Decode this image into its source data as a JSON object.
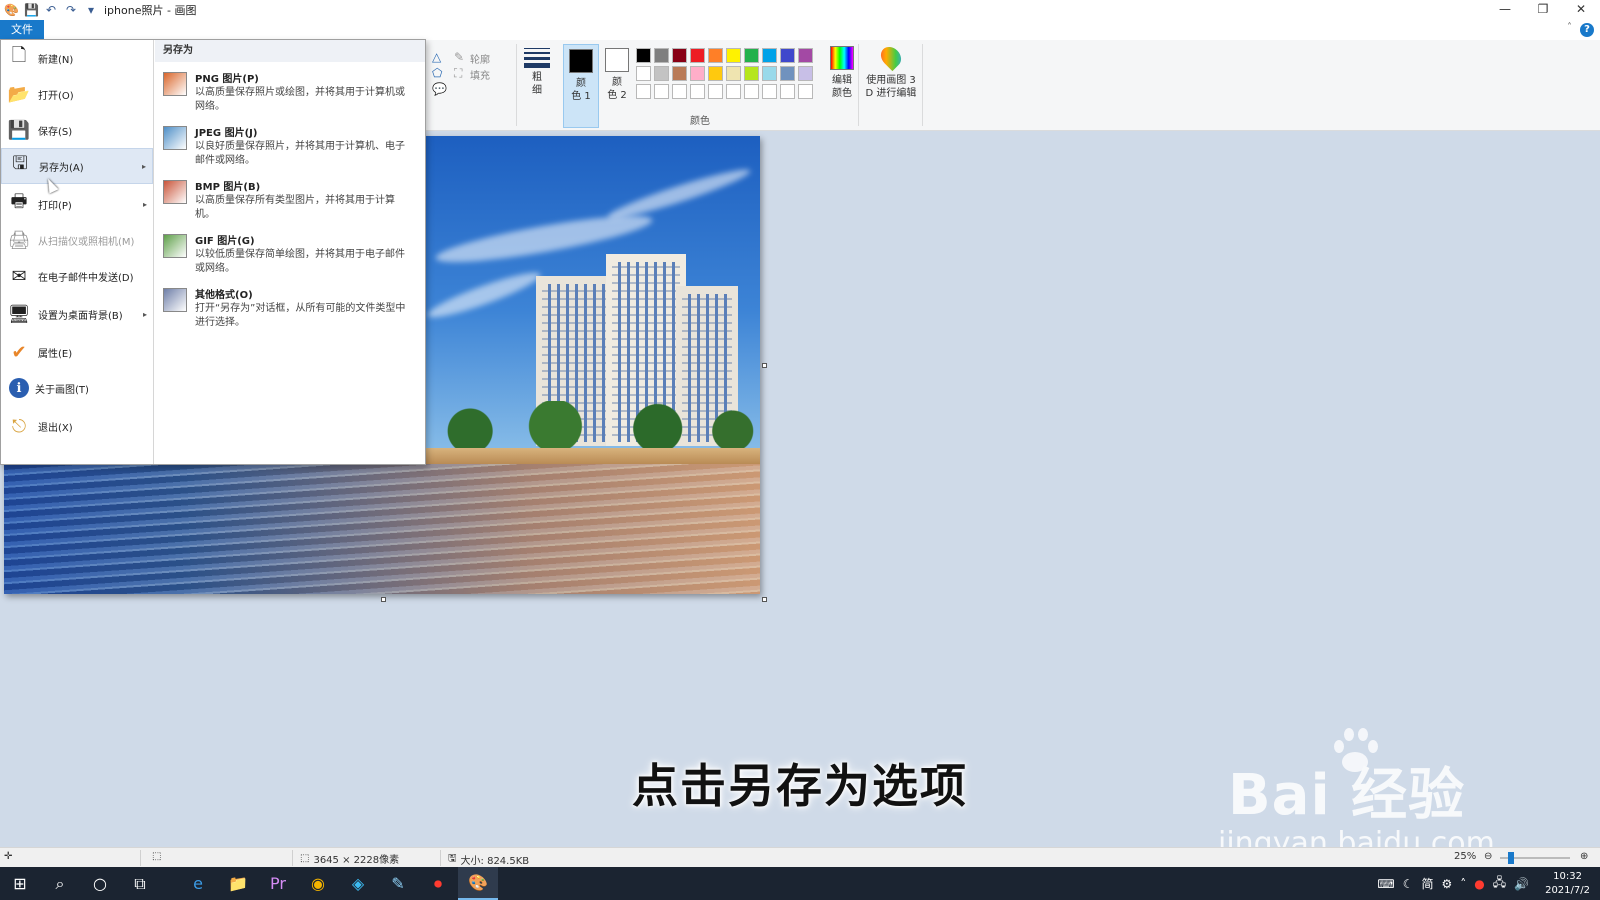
{
  "window": {
    "title": "iphone照片 - 画图",
    "controls": [
      "—",
      "❐",
      "✕"
    ]
  },
  "ribbon": {
    "file_tab": "文件",
    "help": "?",
    "outline_label": "轮廓",
    "fill_label": "填充",
    "size_label": "粗\n细",
    "color1_label": "颜\n色 1",
    "color2_label": "颜\n色 2",
    "colors_group": "颜色",
    "edit_colors_label": "编辑\n颜色",
    "paint3d_label": "使用画图 3\nD 进行编辑",
    "color1": "#000000",
    "color2": "#ffffff",
    "palette": [
      "#000000",
      "#7f7f7f",
      "#880015",
      "#ed1c24",
      "#ff7f27",
      "#fff200",
      "#22b14c",
      "#00a2e8",
      "#3f48cc",
      "#a349a4",
      "#ffffff",
      "#c3c3c3",
      "#b97a57",
      "#ffaec9",
      "#ffc90e",
      "#efe4b0",
      "#b5e61d",
      "#99d9ea",
      "#7092be",
      "#c8bfe7",
      "#ffffff",
      "#ffffff",
      "#ffffff",
      "#ffffff",
      "#ffffff",
      "#ffffff",
      "#ffffff",
      "#ffffff",
      "#ffffff",
      "#ffffff"
    ]
  },
  "file_menu": {
    "items": [
      {
        "label": "新建(N)",
        "icon": "new-file-icon",
        "glyph": "🗋",
        "has_submenu": false,
        "disabled": false
      },
      {
        "label": "打开(O)",
        "icon": "open-folder-icon",
        "glyph": "📂",
        "has_submenu": false,
        "disabled": false
      },
      {
        "label": "保存(S)",
        "icon": "save-icon",
        "glyph": "💾",
        "has_submenu": false,
        "disabled": false
      },
      {
        "label": "另存为(A)",
        "icon": "save-as-icon",
        "glyph": "🖫",
        "has_submenu": true,
        "disabled": false
      },
      {
        "label": "打印(P)",
        "icon": "printer-icon",
        "glyph": "🖶",
        "has_submenu": true,
        "disabled": false
      },
      {
        "label": "从扫描仪或照相机(M)",
        "icon": "scanner-icon",
        "glyph": "🖨",
        "has_submenu": false,
        "disabled": true
      },
      {
        "label": "在电子邮件中发送(D)",
        "icon": "email-icon",
        "glyph": "✉",
        "has_submenu": false,
        "disabled": false
      },
      {
        "label": "设置为桌面背景(B)",
        "icon": "desktop-background-icon",
        "glyph": "🖥",
        "has_submenu": true,
        "disabled": false
      },
      {
        "label": "属性(E)",
        "icon": "properties-check-icon",
        "glyph": "✔",
        "has_submenu": false,
        "disabled": false
      },
      {
        "label": "关于画图(T)",
        "icon": "info-icon",
        "glyph": "ℹ",
        "has_submenu": false,
        "disabled": false
      },
      {
        "label": "退出(X)",
        "icon": "exit-icon",
        "glyph": "⎋",
        "has_submenu": false,
        "disabled": false
      }
    ],
    "selected_index": 3,
    "submenu_title": "另存为",
    "submenu_items": [
      {
        "title": "PNG 图片(P)",
        "desc": "以高质量保存照片或绘图，并将其用于计算机或网络。",
        "icon": "png-image-icon",
        "color": "#d9662b"
      },
      {
        "title": "JPEG 图片(J)",
        "desc": "以良好质量保存照片，并将其用于计算机、电子邮件或网络。",
        "icon": "jpeg-image-icon",
        "color": "#4f8fc7"
      },
      {
        "title": "BMP 图片(B)",
        "desc": "以高质量保存所有类型图片，并将其用于计算机。",
        "icon": "bmp-image-icon",
        "color": "#c9553a"
      },
      {
        "title": "GIF 图片(G)",
        "desc": "以较低质量保存简单绘图，并将其用于电子邮件或网络。",
        "icon": "gif-image-icon",
        "color": "#5fa04a"
      },
      {
        "title": "其他格式(O)",
        "desc": "打开“另存为”对话框，从所有可能的文件类型中进行选择。",
        "icon": "other-formats-icon",
        "color": "#6f7fa8"
      }
    ]
  },
  "caption": "点击另存为选项",
  "watermark": {
    "main": "Bai 经验",
    "sub": "jingyan.baidu.com"
  },
  "status": {
    "dimensions": "3645 × 2228像素",
    "size": "大小: 824.5KB",
    "zoom": "25%"
  },
  "taskbar": {
    "tray_text": "简",
    "time": "10:32",
    "date": "2021/7/2"
  }
}
